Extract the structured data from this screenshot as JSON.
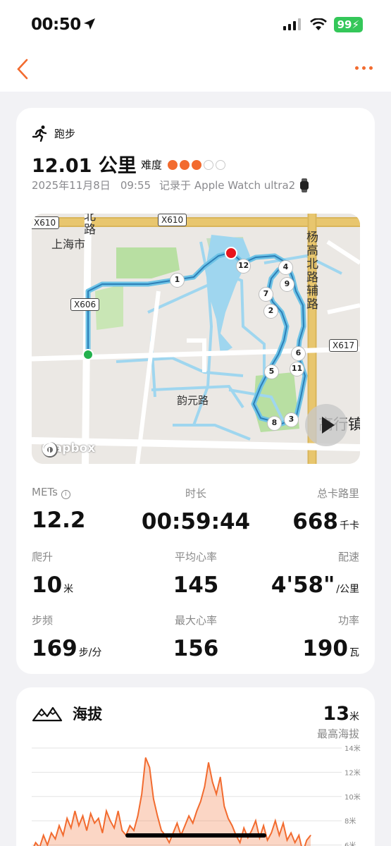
{
  "status_bar": {
    "time": "00:50",
    "battery": "99"
  },
  "activity": {
    "type": "跑步",
    "distance": "12.01 公里",
    "difficulty_label": "难度",
    "difficulty_level": 3,
    "difficulty_max": 5,
    "date": "2025年11月8日",
    "time": "09:55",
    "device": "记录于 Apple Watch ultra2"
  },
  "map": {
    "roads": [
      "X610",
      "X606",
      "X617"
    ],
    "place_labels": [
      "上海市",
      "韵元路"
    ],
    "vertical_labels": [
      "北路",
      "杨高北路辅路"
    ],
    "cut_label": "高行镇",
    "markers": [
      "1",
      "2",
      "3",
      "4",
      "5",
      "6",
      "7",
      "8",
      "9",
      "11",
      "12"
    ],
    "attribution": "mapbox"
  },
  "stats": [
    {
      "label": "METs",
      "value": "12.2",
      "unit": ""
    },
    {
      "label": "时长",
      "value": "00:59:44",
      "unit": ""
    },
    {
      "label": "总卡路里",
      "value": "668",
      "unit": "千卡"
    },
    {
      "label": "爬升",
      "value": "10",
      "unit": "米"
    },
    {
      "label": "平均心率",
      "value": "145",
      "unit": ""
    },
    {
      "label": "配速",
      "value": "4'58\"",
      "unit": "/公里"
    },
    {
      "label": "步频",
      "value": "169",
      "unit": "步/分"
    },
    {
      "label": "最大心率",
      "value": "156",
      "unit": ""
    },
    {
      "label": "功率",
      "value": "190",
      "unit": "瓦"
    }
  ],
  "altitude": {
    "title": "海拔",
    "max_value": "13",
    "max_unit": "米",
    "max_label": "最高海拔"
  },
  "chart_data": {
    "type": "area",
    "ylabel": "",
    "yticks": [
      "14米",
      "12米",
      "10米",
      "8米",
      "6米"
    ],
    "ylim": [
      4,
      14
    ],
    "values": [
      5.5,
      6.2,
      5.8,
      6.8,
      6.0,
      7.0,
      6.5,
      7.6,
      6.8,
      8.2,
      7.4,
      8.8,
      7.6,
      8.4,
      7.2,
      8.6,
      7.8,
      8.2,
      7.0,
      8.8,
      8.0,
      7.4,
      8.8,
      7.2,
      6.8,
      7.6,
      7.2,
      8.4,
      10.2,
      13.2,
      12.4,
      9.8,
      8.4,
      7.2,
      6.8,
      6.2,
      7.0,
      7.8,
      6.8,
      7.6,
      8.4,
      7.8,
      8.8,
      9.6,
      10.8,
      12.8,
      11.2,
      10.2,
      11.6,
      9.2,
      8.2,
      7.6,
      6.8,
      6.2,
      7.4,
      6.6,
      7.2,
      8.0,
      6.6,
      7.6,
      6.4,
      7.0,
      8.0,
      6.8,
      7.8,
      6.4,
      7.0,
      6.2,
      6.8,
      5.4,
      6.4,
      6.8
    ]
  }
}
